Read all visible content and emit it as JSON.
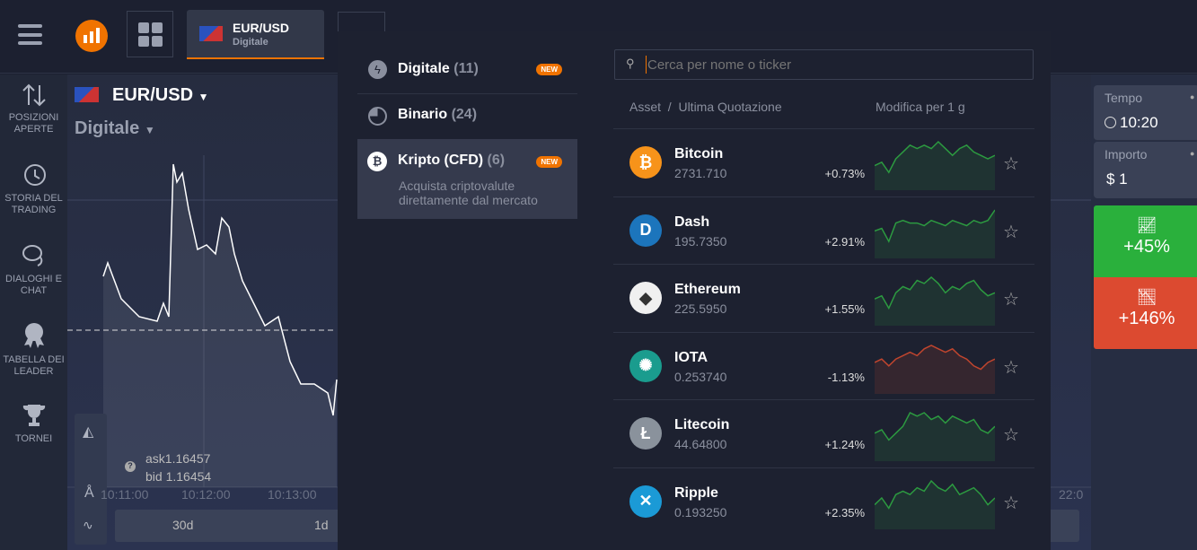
{
  "topbar": {
    "asset_tab": {
      "name": "EUR/USD",
      "type": "Digitale"
    }
  },
  "sidebar": {
    "items": [
      {
        "label": "POSIZIONI APERTE",
        "icon": "arrows-up-down-icon"
      },
      {
        "label": "STORIA DEL TRADING",
        "icon": "history-icon"
      },
      {
        "label": "DIALOGHI E CHAT",
        "icon": "chat-icon"
      },
      {
        "label": "TABELLA DEI LEADER",
        "icon": "medal-icon"
      },
      {
        "label": "TORNEI",
        "icon": "trophy-icon"
      }
    ]
  },
  "chart": {
    "asset": "EUR/USD",
    "type": "Digitale",
    "ask": "ask1.16457",
    "bid": "bid 1.16454",
    "times": [
      "10:11:00",
      "10:12:00",
      "10:13:00"
    ],
    "right_time": "22:0",
    "periods": [
      "30d",
      "1d"
    ]
  },
  "picker": {
    "categories": [
      {
        "label": "Digitale",
        "count": "(11)",
        "badge": "NEW",
        "icon": "lightning-icon"
      },
      {
        "label": "Binario",
        "count": "(24)",
        "badge": "",
        "icon": "pie-clock-icon"
      },
      {
        "label": "Kripto (CFD)",
        "count": "(6)",
        "badge": "NEW",
        "icon": "bitcoin-icon",
        "desc": "Acquista criptovalute direttamente dal mercato",
        "selected": true
      }
    ],
    "search_placeholder": "Cerca per nome o ticker",
    "col_asset": "Asset  /  Ultima Quotazione",
    "col_change": "Modifica per 1 g",
    "assets": [
      {
        "name": "Bitcoin",
        "price": "2731.710",
        "change": "+0.73%",
        "color": "#f7931a",
        "symbol": "₿",
        "trend": [
          3,
          4,
          1,
          5,
          7,
          9,
          8,
          9,
          8,
          10,
          8,
          6,
          8,
          9,
          7,
          6,
          5,
          6
        ]
      },
      {
        "name": "Dash",
        "price": "195.7350",
        "change": "+2.91%",
        "color": "#1c75bc",
        "symbol": "D",
        "trend": [
          5,
          6,
          1,
          8,
          9,
          8,
          8,
          7,
          9,
          8,
          7,
          9,
          8,
          7,
          9,
          8,
          9,
          13
        ]
      },
      {
        "name": "Ethereum",
        "price": "225.5950",
        "change": "+1.55%",
        "color": "#f0f0f0",
        "symbol": "◆",
        "trend": [
          4,
          5,
          1,
          6,
          8,
          7,
          10,
          9,
          11,
          9,
          6,
          8,
          7,
          9,
          10,
          7,
          5,
          6
        ]
      },
      {
        "name": "IOTA",
        "price": "0.253740",
        "change": "-1.13%",
        "color": "#1a9c8e",
        "symbol": "✺",
        "trend": [
          5,
          6,
          4,
          6,
          7,
          8,
          7,
          9,
          10,
          9,
          8,
          9,
          7,
          6,
          4,
          3,
          5,
          6
        ]
      },
      {
        "name": "Litecoin",
        "price": "44.64800",
        "change": "+1.24%",
        "color": "#8a929c",
        "symbol": "Ł",
        "trend": [
          4,
          5,
          2,
          4,
          6,
          10,
          9,
          10,
          8,
          9,
          7,
          9,
          8,
          7,
          8,
          5,
          4,
          6
        ]
      },
      {
        "name": "Ripple",
        "price": "0.193250",
        "change": "+2.35%",
        "color": "#1b9ad6",
        "symbol": "✕",
        "trend": [
          3,
          5,
          2,
          6,
          7,
          6,
          8,
          7,
          10,
          8,
          7,
          9,
          6,
          7,
          8,
          6,
          3,
          5
        ]
      }
    ]
  },
  "trade": {
    "time_label": "Tempo",
    "time": "10:20",
    "amount_label": "Importo",
    "amount": "$ 1",
    "call": "+45%",
    "put": "+146%",
    "call_color": "#2ab03c",
    "put_color": "#dc4a30"
  }
}
